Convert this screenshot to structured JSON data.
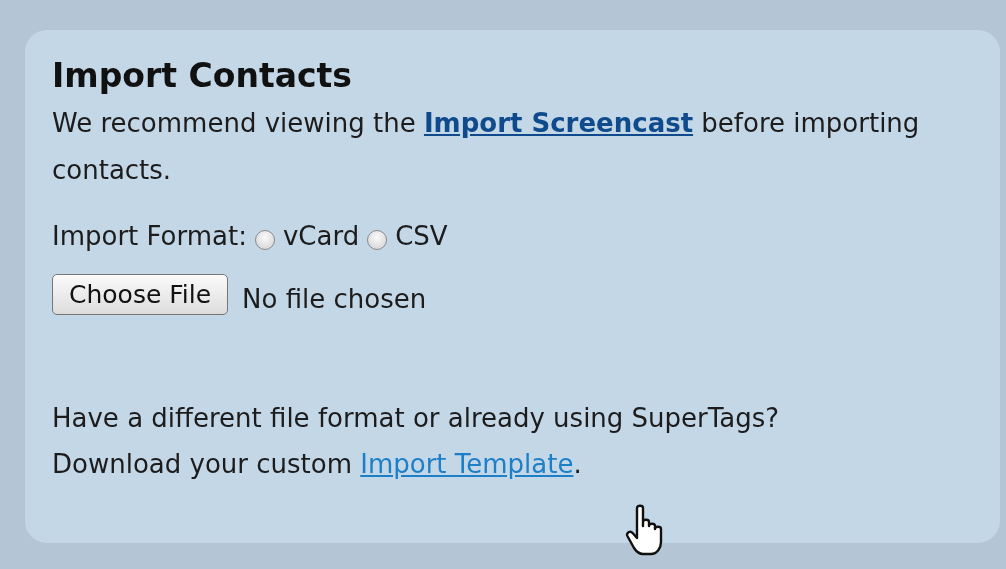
{
  "heading": "Import Contacts",
  "intro": {
    "before": "We recommend viewing the ",
    "link": "Import Screencast",
    "after": " before importing contacts."
  },
  "format": {
    "label": "Import Format:",
    "options": [
      {
        "label": "vCard",
        "selected": false
      },
      {
        "label": "CSV",
        "selected": false
      }
    ]
  },
  "file": {
    "button": "Choose File",
    "status": "No file chosen"
  },
  "footer": {
    "line1": "Have a different file format or already using SuperTags?",
    "before": "Download your custom ",
    "link": "Import Template",
    "after": "."
  }
}
